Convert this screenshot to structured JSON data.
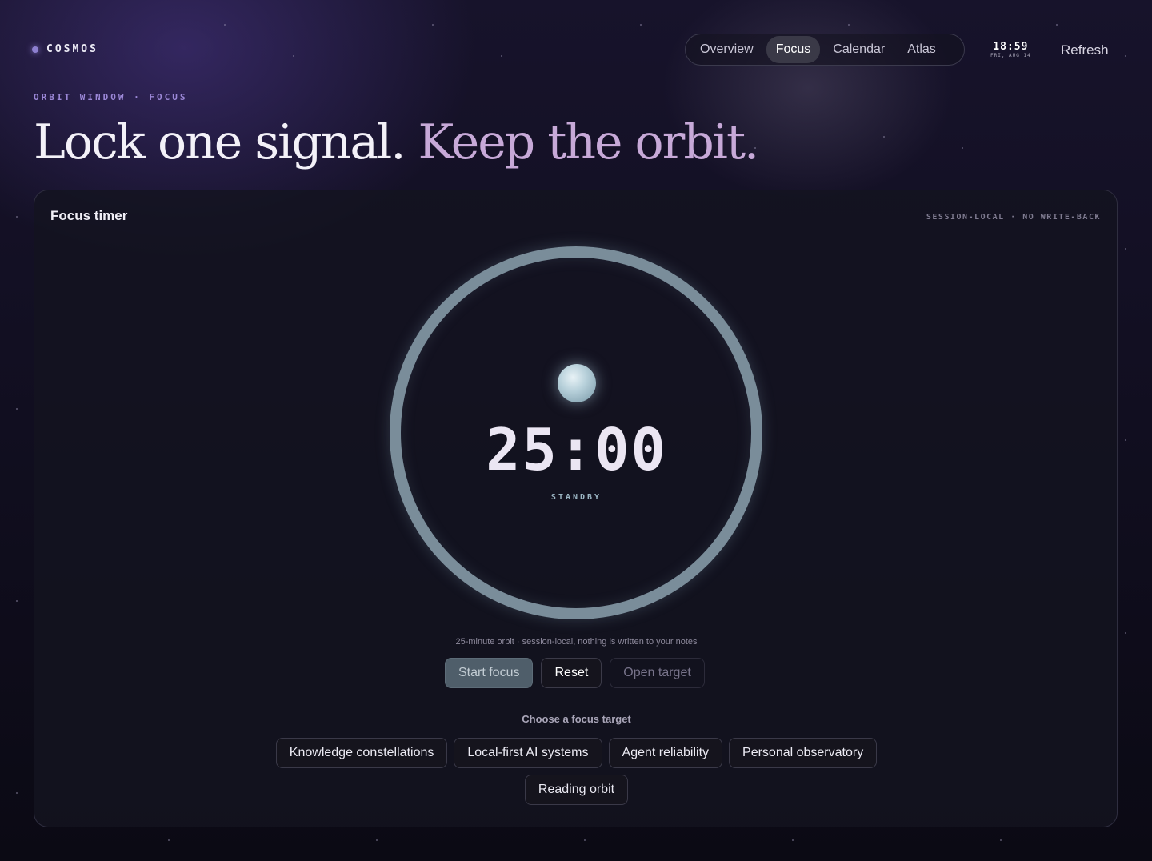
{
  "brand": {
    "name": "COSMOS"
  },
  "nav": {
    "items": [
      {
        "label": "Overview",
        "active": false
      },
      {
        "label": "Focus",
        "active": true
      },
      {
        "label": "Calendar",
        "active": false
      },
      {
        "label": "Atlas",
        "active": false
      }
    ]
  },
  "clock": {
    "time": "18:59",
    "date": "FRI, AUG 14"
  },
  "header": {
    "refresh_label": "Refresh"
  },
  "hero": {
    "eyebrow": "ORBIT WINDOW · FOCUS",
    "title_main": "Lock one signal.",
    "title_accent": "Keep the orbit."
  },
  "panel": {
    "title": "Focus timer",
    "meta": "SESSION-LOCAL · NO WRITE-BACK",
    "timer": {
      "display": "25:00",
      "status": "STANDBY"
    },
    "hint": "25-minute orbit · session-local, nothing is written to your notes",
    "buttons": {
      "start": "Start focus",
      "reset": "Reset",
      "open": "Open target"
    },
    "choose_label": "Choose a focus target",
    "targets": [
      "Knowledge constellations",
      "Local-first AI systems",
      "Agent reliability",
      "Personal observatory",
      "Reading orbit"
    ]
  },
  "colors": {
    "accent": "#c7a9d8",
    "ring": "#7a8d9a",
    "eyebrow": "#9c88d8"
  }
}
